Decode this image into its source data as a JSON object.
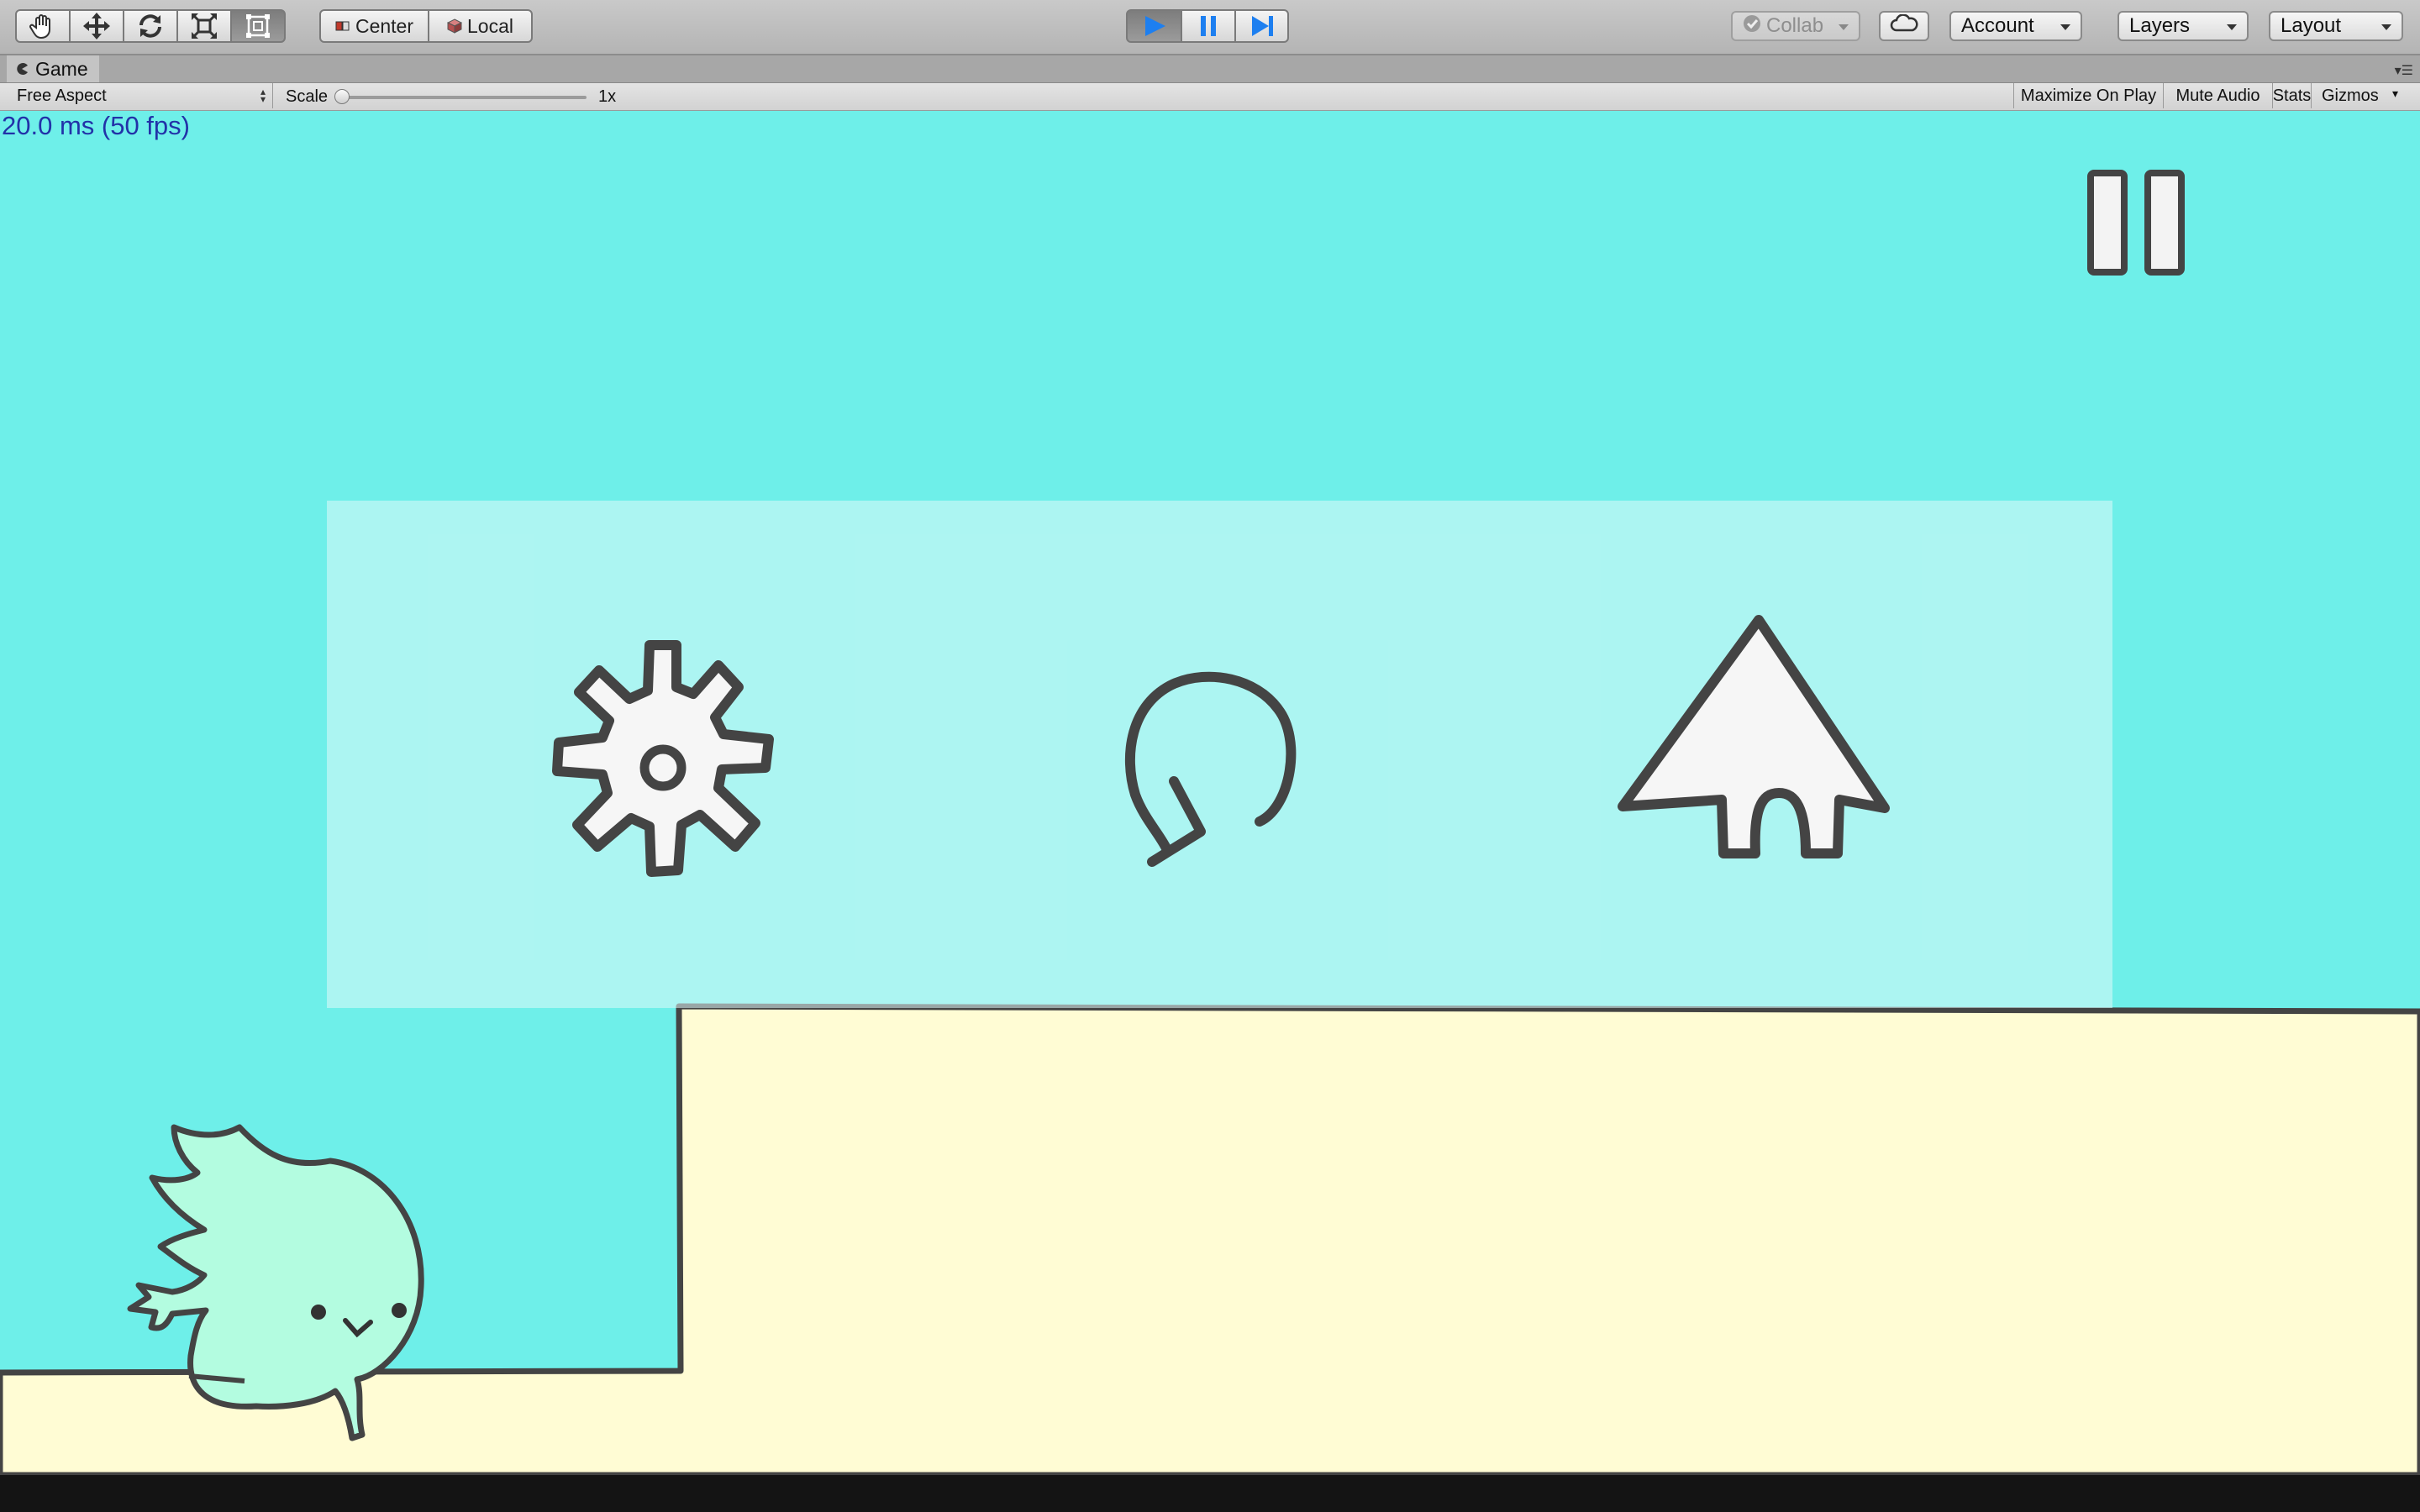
{
  "toolbar": {
    "transform_tools": [
      "hand-tool",
      "move-tool",
      "rotate-tool",
      "scale-tool",
      "rect-tool"
    ],
    "active_tool": "rect-tool",
    "pivot_mode_label": "Center",
    "pivot_space_label": "Local",
    "playback": [
      "play",
      "pause",
      "step"
    ],
    "play_active": true,
    "collab_label": "Collab",
    "account_label": "Account",
    "layers_label": "Layers",
    "layout_label": "Layout"
  },
  "game_window": {
    "tab_label": "Game",
    "aspect_label": "Free Aspect",
    "scale_label": "Scale",
    "scale_value": "1x",
    "scale_fraction": 0.0,
    "maximize_label": "Maximize On Play",
    "mute_label": "Mute Audio",
    "stats_label": "Stats",
    "gizmos_label": "Gizmos"
  },
  "game": {
    "fps_text": "20.0 ms (50 fps)",
    "menu_buttons": [
      "settings-gear",
      "restart-arrow",
      "home-house"
    ],
    "colors": {
      "sky": "#6eefe9",
      "ground": "#fffcd4",
      "panel": "#b3f6f4",
      "character": "#b3fce0",
      "outline": "#444444"
    }
  }
}
